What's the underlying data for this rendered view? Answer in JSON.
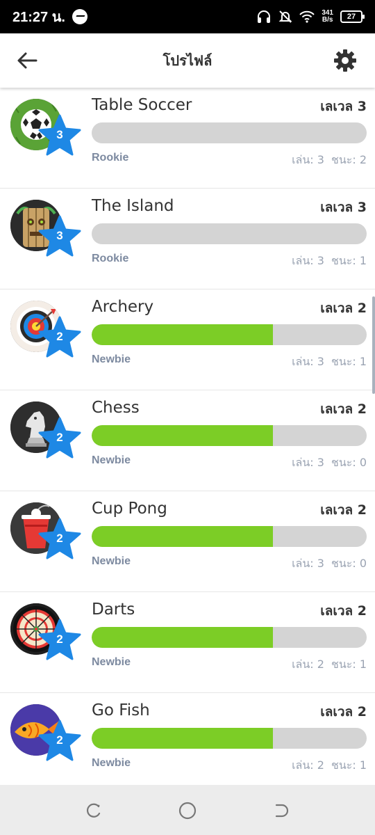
{
  "status_bar": {
    "time": "21:27 น.",
    "speed_top": "341",
    "speed_bottom": "B/s",
    "battery": "27"
  },
  "header": {
    "title": "โปรไฟล์"
  },
  "games": [
    {
      "name": "Table Soccer",
      "level_label": "เลเวล 3",
      "badge": "3",
      "progress": 0,
      "rank": "Rookie",
      "played": "เล่น: 3",
      "won": "ชนะ: 2",
      "icon": "soccer-ball-icon"
    },
    {
      "name": "The Island",
      "level_label": "เลเวล 3",
      "badge": "3",
      "progress": 0,
      "rank": "Rookie",
      "played": "เล่น: 3",
      "won": "ชนะ: 1",
      "icon": "tiki-icon"
    },
    {
      "name": "Archery",
      "level_label": "เลเวล 2",
      "badge": "2",
      "progress": 0.66,
      "rank": "Newbie",
      "played": "เล่น: 3",
      "won": "ชนะ: 1",
      "icon": "target-icon"
    },
    {
      "name": "Chess",
      "level_label": "เลเวล 2",
      "badge": "2",
      "progress": 0.66,
      "rank": "Newbie",
      "played": "เล่น: 3",
      "won": "ชนะ: 0",
      "icon": "chess-knight-icon"
    },
    {
      "name": "Cup Pong",
      "level_label": "เลเวล 2",
      "badge": "2",
      "progress": 0.66,
      "rank": "Newbie",
      "played": "เล่น: 3",
      "won": "ชนะ: 0",
      "icon": "red-cup-icon"
    },
    {
      "name": "Darts",
      "level_label": "เลเวล 2",
      "badge": "2",
      "progress": 0.66,
      "rank": "Newbie",
      "played": "เล่น: 2",
      "won": "ชนะ: 1",
      "icon": "dartboard-icon"
    },
    {
      "name": "Go Fish",
      "level_label": "เลเวล 2",
      "badge": "2",
      "progress": 0.66,
      "rank": "Newbie",
      "played": "เล่น: 2",
      "won": "ชนะ: 1",
      "icon": "fish-icon"
    }
  ],
  "colors": {
    "progress_fill": "#7ccd26",
    "progress_track": "#d4d4d4",
    "star": "#1e88e5",
    "rank_text": "#7d8aa0"
  }
}
